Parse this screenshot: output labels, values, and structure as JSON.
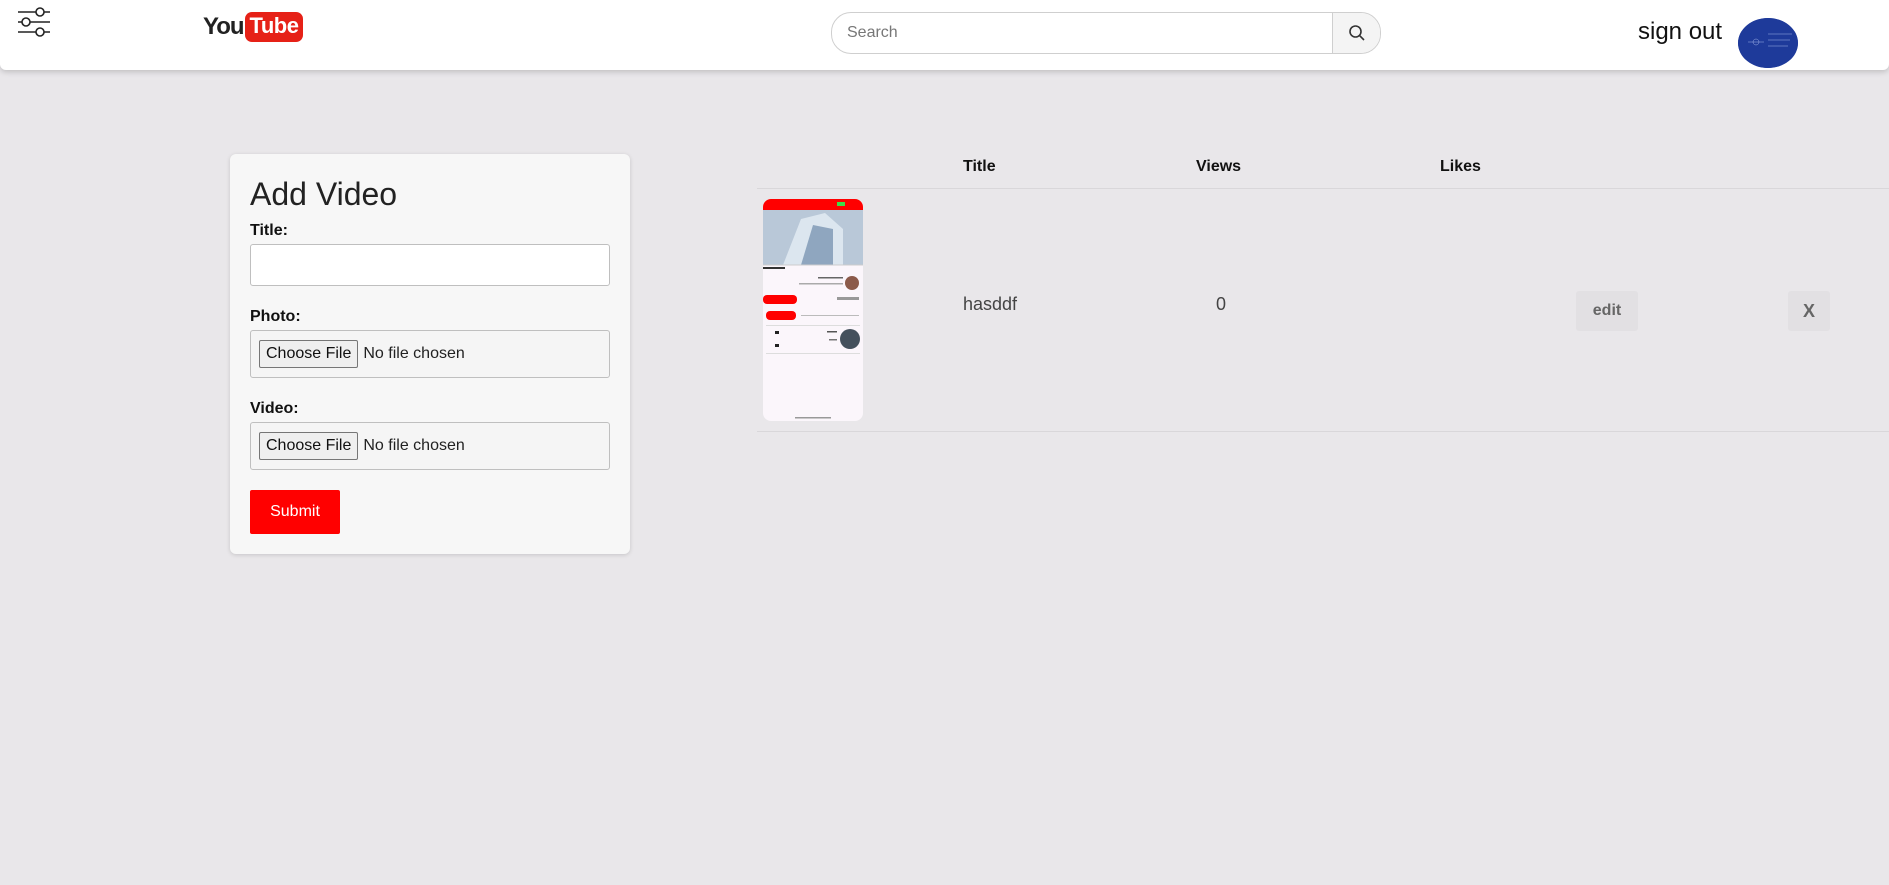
{
  "header": {
    "logo_you": "You",
    "logo_tube": "Tube",
    "search_placeholder": "Search",
    "signout_label": "sign out"
  },
  "form": {
    "title": "Add Video",
    "title_label": "Title:",
    "photo_label": "Photo:",
    "video_label": "Video:",
    "choose_file_label": "Choose File",
    "no_file_text": "No file chosen",
    "submit_label": "Submit"
  },
  "table": {
    "headers": [
      "Title",
      "Views",
      "Likes"
    ],
    "rows": [
      {
        "title": "hasddf",
        "views": "0",
        "likes": "",
        "edit_label": "edit",
        "delete_label": "X"
      }
    ]
  },
  "colors": {
    "accent": "#ff0000",
    "page_bg": "#e9e7ea",
    "avatar": "#1e3a9a"
  },
  "icons": [
    "menu-sliders-icon",
    "search-icon"
  ]
}
